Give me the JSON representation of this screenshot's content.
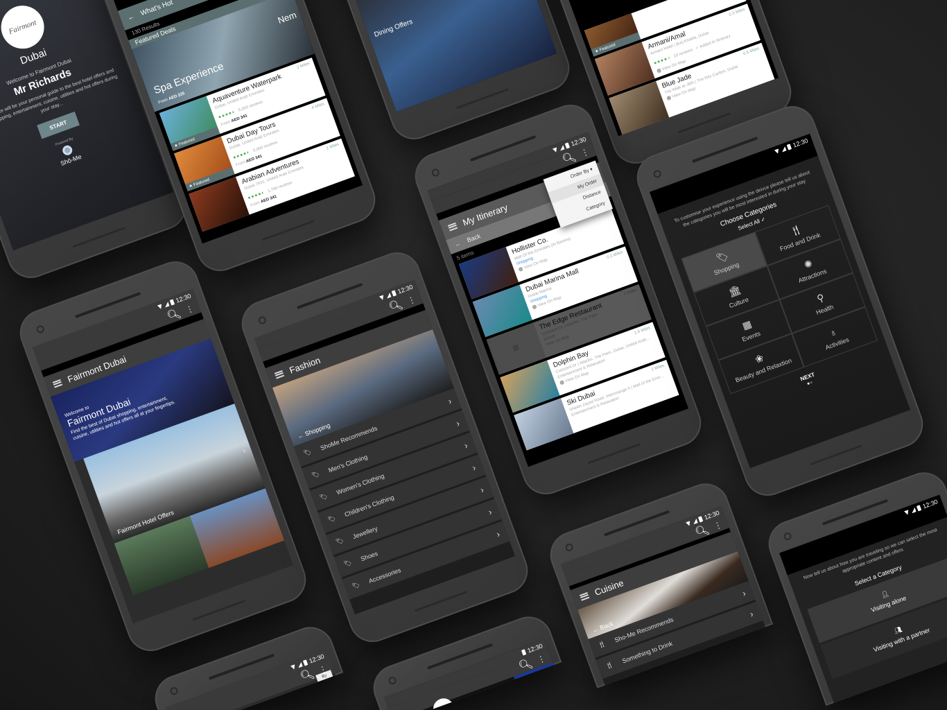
{
  "status": {
    "time": "12:30"
  },
  "welcome": {
    "logo": "Fairmont",
    "city": "Dubai",
    "greeting": "Welcome to Fairmont Dubai",
    "name": "Mr Richards",
    "body": "This device will be your personal guide to the best hotel offers and local shopping, entertainment, cuisine, utilities and hot offers during your stay...",
    "start": "START",
    "powered": "Powered By",
    "brand": "Shō-Me"
  },
  "whats_hot": {
    "title": "What's Hot",
    "results": "130 Results",
    "featured_deals": "Featured Deals",
    "hero": {
      "title": "Spa Experience",
      "from": "From",
      "price": "AED 225"
    },
    "hero2": {
      "title": "Nem",
      "from": "From",
      "price": "AED"
    },
    "featured_label": "Featured",
    "items": [
      {
        "name": "Aquaventure Waterpark",
        "location": "Dubai, United Arab Emirates",
        "reviews": "5,000 reviews",
        "rating": 4.5,
        "from": "From",
        "price": "AED 341",
        "distance": "2 Miles"
      },
      {
        "name": "Dubai Day Tours",
        "location": "Dubai, United Arab Emirates",
        "reviews": "5,000 reviews",
        "rating": 4.5,
        "from": "From",
        "price": "AED 341",
        "distance": "4 Miles"
      },
      {
        "name": "Arabian Adventures",
        "location": "Dubai 7631, United Arab Emirates",
        "reviews": "1,760 reviews",
        "rating": 4.5,
        "from": "From",
        "price": "AED 341",
        "distance": "1 Miles"
      }
    ]
  },
  "dining": {
    "label": "Dining Offers"
  },
  "restaurants": {
    "featured_label": "Featured",
    "items": [
      {
        "name": "Armani/Amal",
        "location": "Armani Hotel | Burj Khalifa, Dubai",
        "reviews": "10 reviews",
        "rating": 4,
        "added": "Added to Itinerary",
        "map": "View On Map",
        "distance": "0.3 Miles"
      },
      {
        "name": "Blue Jade",
        "location": "The Walk at JBR | The Ritz-Carlton, Dubai",
        "map": "View On Map",
        "distance": "0.5 Miles"
      }
    ]
  },
  "itinerary": {
    "title": "My Itinerary",
    "back": "Back",
    "count": "5 items",
    "order_by": "Order By",
    "order_options": [
      "My Order",
      "Distance",
      "Category"
    ],
    "items": [
      {
        "name": "Hollister Co.",
        "location": "Mall Of the Emirates (Al Barsha)",
        "category": "Shopping",
        "map": "View On Map",
        "distance": ""
      },
      {
        "name": "Dubai Marina Mall",
        "location": "Dubai Marina",
        "category": "Shopping",
        "map": "View On Map",
        "distance": "0.2 Miles"
      },
      {
        "name": "The Edge Restaurant",
        "location": "Crescent Dr | Atlantis, The Palm",
        "category": "Dinner",
        "map": "View On Map",
        "distance": "1 Miles"
      },
      {
        "name": "Dolphin Bay",
        "location": "Crescent Dr | Atlantis, The Palm, Dubai, United Arab...",
        "category": "Entertainment & Relaxation",
        "map": "View On Map",
        "distance": "1.5 Miles"
      },
      {
        "name": "Ski Dubai",
        "location": "Sheikh Zayed Road, Interchange 4 | Mall of the Emir...",
        "category": "Entertainment & Relaxation",
        "map": "",
        "distance": "2 Miles"
      }
    ]
  },
  "categories": {
    "intro": "To customise your experience using the deivce please tell us about the categories you will be most interested in during your stay",
    "heading": "Choose Categories",
    "select_all": "Select All",
    "next": "NEXT",
    "page": 1,
    "pages": 2,
    "items": [
      {
        "label": "Shopping",
        "icon": "tag",
        "selected": true
      },
      {
        "label": "Food and Drink",
        "icon": "cutlery"
      },
      {
        "label": "Culture",
        "icon": "building"
      },
      {
        "label": "Attractions",
        "icon": "ferris-wheel"
      },
      {
        "label": "Events",
        "icon": "calendar"
      },
      {
        "label": "Health",
        "icon": "bike"
      },
      {
        "label": "Beauty and Relaxtion",
        "icon": "spa"
      },
      {
        "label": "Activities",
        "icon": "bag"
      }
    ]
  },
  "home": {
    "title": "Fairmont Dubai",
    "welcome": "Welcome to",
    "hotel": "Fairmont Dubai",
    "body": "Find the best of Dubai shopping, entertainment, cuisine, utilities and hot offers all at your fingertips.",
    "offers": "Fairmont Hotel Offers"
  },
  "fashion": {
    "title": "Fashion",
    "hero": "Shopping",
    "items": [
      "ShoMe Recommends",
      "Men's Clothing",
      "Women's Clothing",
      "Children's Clothing",
      "Jewellery",
      "Shoes",
      "Accessories"
    ]
  },
  "cuisine": {
    "title": "Cuisine",
    "back": "Back",
    "items": [
      "Sho-Me Recommends",
      "Something to Drink"
    ]
  },
  "travel": {
    "intro": "Now tell us about how you are traveling so we can select the most appropriate content and offers",
    "heading": "Select a Category",
    "items": [
      "Visiting alone",
      "Visiting with a partner"
    ]
  },
  "misc": {
    "by": "By"
  }
}
